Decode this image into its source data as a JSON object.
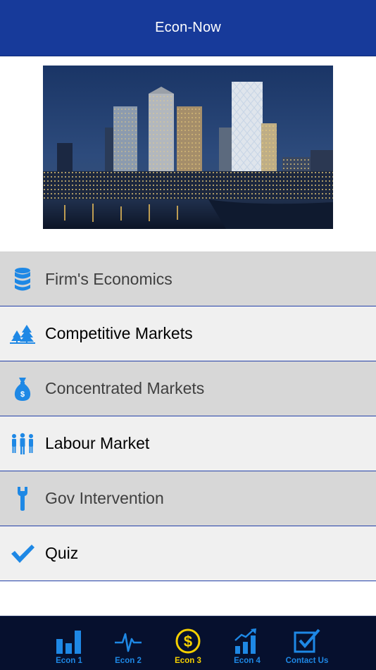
{
  "navbar": {
    "title": "Econ-Now"
  },
  "hero": {
    "icon": "city-skyline-image"
  },
  "colors": {
    "navbar": "#173a9a",
    "accent_blue": "#1e88e5",
    "active_tab": "#f5d000",
    "tabbar": "#06102e",
    "row_dark": "#d7d7d7",
    "row_light": "#f0f0f0"
  },
  "menu": {
    "items": [
      {
        "label": "Firm's Economics",
        "icon": "database-icon"
      },
      {
        "label": "Competitive Markets",
        "icon": "trees-icon"
      },
      {
        "label": "Concentrated Markets",
        "icon": "money-bag-icon"
      },
      {
        "label": "Labour Market",
        "icon": "people-icon"
      },
      {
        "label": "Gov Intervention",
        "icon": "wrench-icon"
      },
      {
        "label": "Quiz",
        "icon": "checkmark-icon"
      }
    ]
  },
  "tabs": [
    {
      "label": "Econ 1",
      "icon": "bar-chart-icon",
      "active": false
    },
    {
      "label": "Econ 2",
      "icon": "pulse-icon",
      "active": false
    },
    {
      "label": "Econ 3",
      "icon": "dollar-circle-icon",
      "active": true
    },
    {
      "label": "Econ 4",
      "icon": "growth-chart-icon",
      "active": false
    },
    {
      "label": "Contact Us",
      "icon": "checkbox-icon",
      "active": false
    }
  ]
}
